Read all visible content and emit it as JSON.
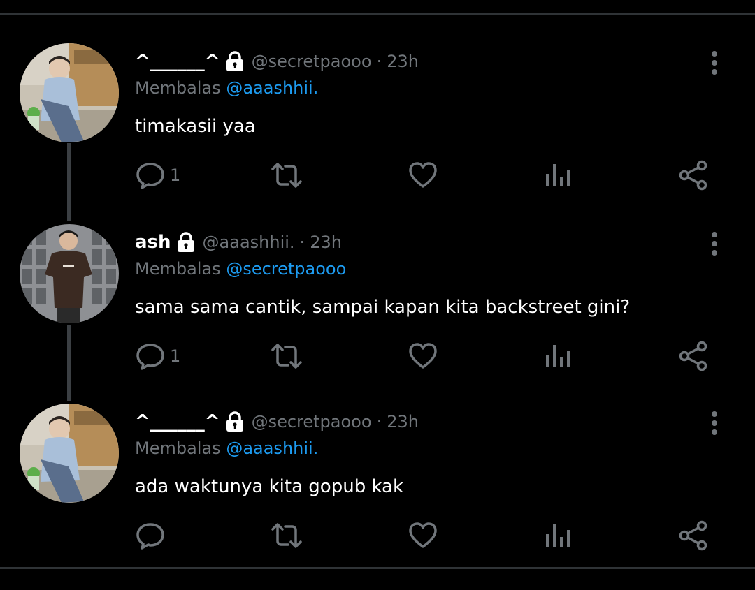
{
  "theme": {
    "background": "#000000",
    "divider": "#2f3336",
    "text_primary": "#ffffff",
    "text_secondary": "#71767b",
    "accent": "#1d9bf0",
    "icon": "#71767b"
  },
  "reply_prefix": "Membalas",
  "tweets": [
    {
      "display_name": "^______^",
      "protected_icon": "lock-icon",
      "handle": "@secretpaooo",
      "separator": "·",
      "time": "23h",
      "reply_to": "@aaashhii.",
      "text": "timakasii yaa",
      "reply_count": "1",
      "avatar": "avatar-photo-light-shirt"
    },
    {
      "display_name": "ash",
      "protected_icon": "lock-icon",
      "handle": "@aaashhii.",
      "separator": "·",
      "time": "23h",
      "reply_to": "@secretpaooo",
      "text": "sama sama cantik, sampai kapan kita backstreet gini?",
      "reply_count": "1",
      "avatar": "avatar-photo-brown-tshirt"
    },
    {
      "display_name": "^______^",
      "protected_icon": "lock-icon",
      "handle": "@secretpaooo",
      "separator": "·",
      "time": "23h",
      "reply_to": "@aaashhii.",
      "text": "ada waktunya kita gopub kak",
      "reply_count": "",
      "avatar": "avatar-photo-light-shirt"
    }
  ],
  "action_icons": [
    "reply-icon",
    "retweet-icon",
    "like-icon",
    "views-icon",
    "share-icon"
  ],
  "more_icon": "more-vertical-icon"
}
